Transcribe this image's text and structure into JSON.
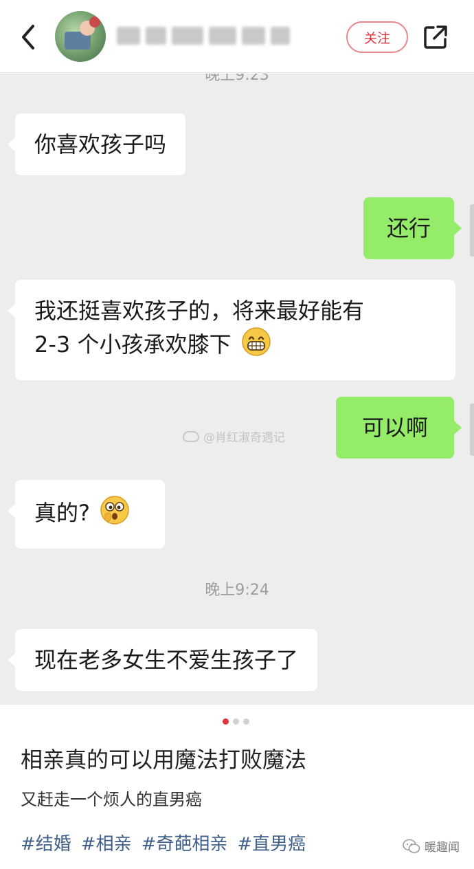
{
  "header": {
    "follow_label": "关注"
  },
  "chat": {
    "timestamps": [
      "晚上9:23",
      "晚上9:24"
    ],
    "watermark": "@肖红淑奇遇记",
    "messages": [
      {
        "side": "left",
        "text": "你喜欢孩子吗"
      },
      {
        "side": "right",
        "text": "还行"
      },
      {
        "side": "left",
        "text_line1": "我还挺喜欢孩子的，将来最好能有",
        "text_line2": "2-3 个小孩承欢膝下",
        "emoji": "grin-emoji"
      },
      {
        "side": "right",
        "text": "可以啊"
      },
      {
        "side": "left",
        "text": "真的?",
        "emoji": "surprised-emoji"
      },
      {
        "side": "left",
        "text": "现在老多女生不爱生孩子了"
      }
    ]
  },
  "post": {
    "carousel_count": 3,
    "carousel_active": 1,
    "title": "相亲真的可以用魔法打败魔法",
    "description": "又赶走一个烦人的直男癌",
    "tags": [
      "#结婚",
      "#相亲",
      "#奇葩相亲",
      "#直男癌"
    ],
    "source_label": "暖趣闻"
  },
  "colors": {
    "accent_red": "#e0353f",
    "sent_bubble": "#95ec69",
    "chat_bg": "#ededed",
    "tag_blue": "#3f5f8a"
  }
}
